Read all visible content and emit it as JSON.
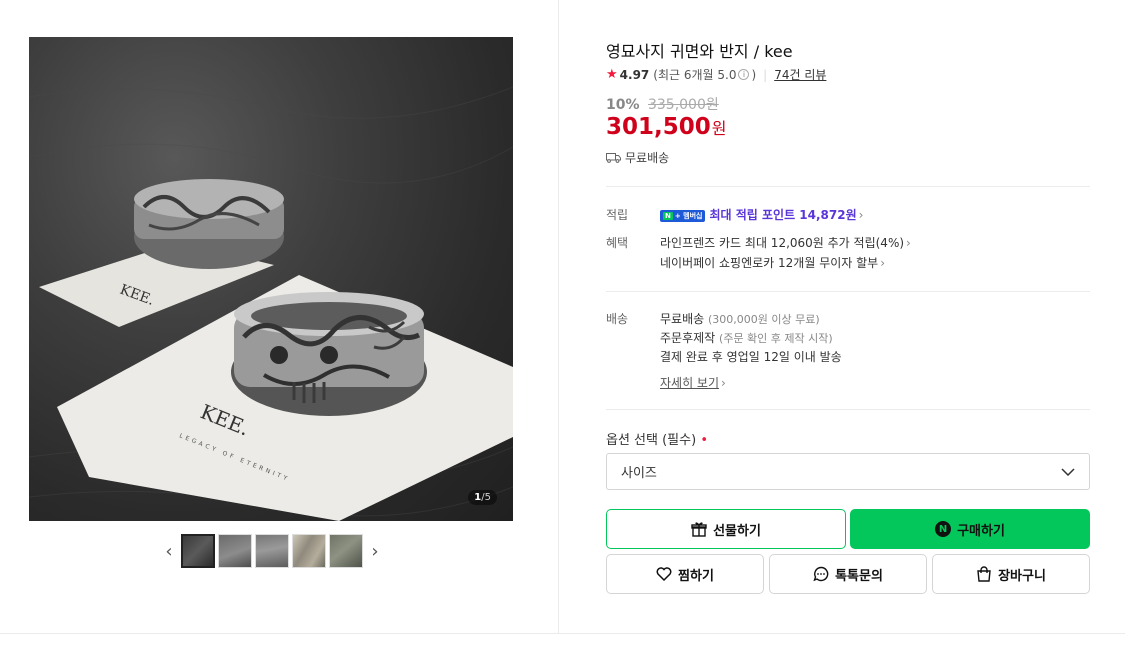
{
  "product": {
    "title": "영묘사지 귀면와 반지 / kee",
    "rating": "4.97",
    "rating_sub_prefix": "(최근 6개월 5.0",
    "rating_sub_suffix": ")",
    "review_link": "74건 리뷰",
    "discount": "10%",
    "original_price": "335,000원",
    "price": "301,500",
    "price_unit": "원",
    "shipping_short": "무료배송"
  },
  "gallery": {
    "page_current": "1",
    "page_total": "/5",
    "prev_arrow": "‹",
    "next_arrow": "›",
    "card_brand": "KEE.",
    "card_tagline": "LEGACY OF ETERNITY"
  },
  "points": {
    "label": "적립",
    "badge_n": "N",
    "badge_text": "+ 멤버십",
    "text": "최대 적립 포인트 14,872원"
  },
  "benefits": {
    "label": "혜택",
    "items": [
      "라인프렌즈 카드 최대 12,060원 추가 적립(4%)",
      "네이버페이 쇼핑엔로카 12개월 무이자 할부"
    ]
  },
  "delivery": {
    "label": "배송",
    "line1_main": "무료배송",
    "line1_sub": "(300,000원 이상 무료)",
    "line2_main": "주문후제작",
    "line2_sub": "(주문 확인 후 제작 시작)",
    "line3": "결제 완료 후 영업일 12일 이내 발송",
    "detail_link": "자세히 보기"
  },
  "options": {
    "label": "옵션 선택 (필수)",
    "required_mark": "•",
    "select_value": "사이즈"
  },
  "buttons": {
    "gift": "선물하기",
    "buy": "구매하기",
    "buy_badge": "N",
    "wish": "찜하기",
    "talk": "톡톡문의",
    "cart": "장바구니"
  },
  "colors": {
    "accent_green": "#03c75a",
    "price_red": "#d0021b",
    "points_purple": "#5a36d9"
  }
}
